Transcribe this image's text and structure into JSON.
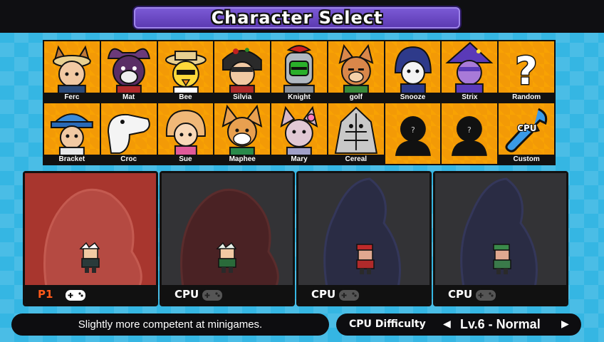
{
  "title": "Character Select",
  "characters_row1": [
    {
      "name": "Ferc",
      "icon": "ferc-portrait-icon"
    },
    {
      "name": "Mat",
      "icon": "mat-portrait-icon"
    },
    {
      "name": "Bee",
      "icon": "bee-portrait-icon"
    },
    {
      "name": "Silvia",
      "icon": "silvia-portrait-icon"
    },
    {
      "name": "Knight",
      "icon": "knight-portrait-icon"
    },
    {
      "name": "golf",
      "icon": "golf-portrait-icon"
    },
    {
      "name": "Snooze",
      "icon": "snooze-portrait-icon"
    },
    {
      "name": "Strix",
      "icon": "strix-portrait-icon"
    },
    {
      "name": "Random",
      "icon": "question-mark-icon"
    }
  ],
  "characters_row2": [
    {
      "name": "Bracket",
      "icon": "bracket-portrait-icon"
    },
    {
      "name": "Croc",
      "icon": "croc-portrait-icon"
    },
    {
      "name": "Sue",
      "icon": "sue-portrait-icon"
    },
    {
      "name": "Maphee",
      "icon": "maphee-portrait-icon"
    },
    {
      "name": "Mary",
      "icon": "mary-portrait-icon"
    },
    {
      "name": "Cereal",
      "icon": "cereal-portrait-icon"
    },
    {
      "name": "?",
      "icon": "locked-silhouette-icon"
    },
    {
      "name": "?",
      "icon": "locked-silhouette-icon"
    },
    {
      "name": "Custom",
      "icon": "cpu-wrench-icon",
      "badge": "CPU"
    }
  ],
  "players": [
    {
      "tag": "P1",
      "type": "human",
      "panel_color": "#a8362e"
    },
    {
      "tag": "CPU",
      "type": "cpu",
      "panel_color": "#333336"
    },
    {
      "tag": "CPU",
      "type": "cpu",
      "panel_color": "#333336"
    },
    {
      "tag": "CPU",
      "type": "cpu",
      "panel_color": "#333336"
    }
  ],
  "description": "Slightly more competent at minigames.",
  "difficulty": {
    "label": "CPU Difficulty",
    "value": "Lv.6 - Normal",
    "left_arrow": "◀",
    "right_arrow": "▶"
  },
  "colors": {
    "accent": "#6b46c8",
    "grid_orange": "#f39a06",
    "p1_orange": "#ff5a1a",
    "background": "#35b6e3"
  }
}
